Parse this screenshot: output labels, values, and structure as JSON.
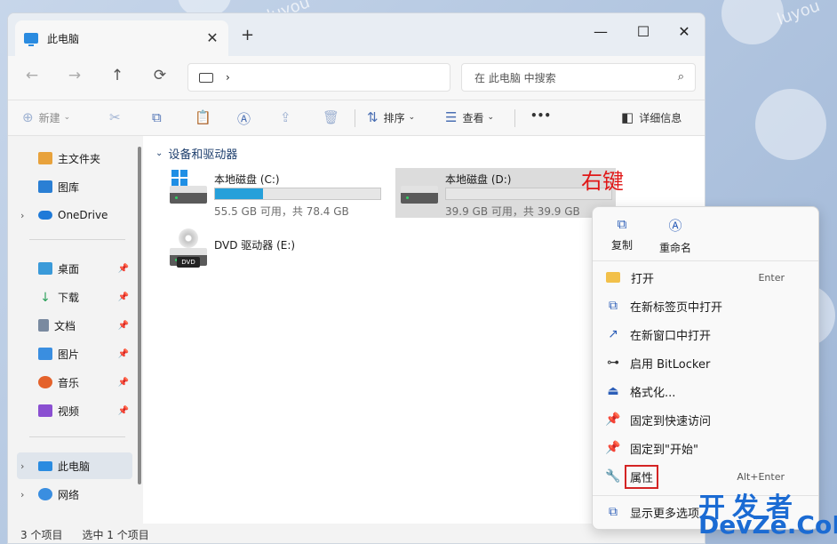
{
  "window": {
    "tab_title": "此电脑",
    "tab_close": "✕",
    "new_tab": "+",
    "minimize": "—",
    "maximize": "☐",
    "close": "✕"
  },
  "nav_buttons": {
    "back": "←",
    "forward": "→",
    "up": "↑",
    "refresh": "⟳"
  },
  "address": {
    "chevron": "›"
  },
  "search": {
    "placeholder": "在 此电脑 中搜索",
    "icon": "⌕"
  },
  "toolbar": {
    "new": "新建",
    "sort": "排序",
    "view": "查看",
    "more": "•••",
    "details": "详细信息"
  },
  "sidebar": {
    "items": [
      {
        "label": "主文件夹",
        "color": "#e8a23c"
      },
      {
        "label": "图库",
        "color": "#2a7fd4"
      },
      {
        "label": "OneDrive",
        "color": "#1f7ad8"
      },
      {
        "label": "桌面",
        "color": "#3a9ad9"
      },
      {
        "label": "下载",
        "color": "#2aa05a"
      },
      {
        "label": "文档",
        "color": "#7a8aa0"
      },
      {
        "label": "图片",
        "color": "#3a8ee0"
      },
      {
        "label": "音乐",
        "color": "#e4622b"
      },
      {
        "label": "视频",
        "color": "#8a4fd1"
      },
      {
        "label": "此电脑",
        "color": "#2a8be0"
      },
      {
        "label": "网络",
        "color": "#3a8ee0"
      }
    ]
  },
  "content": {
    "group_title": "设备和驱动器",
    "drives": [
      {
        "name": "本地磁盘 (C:)",
        "size": "55.5 GB 可用，共 78.4 GB",
        "used_fraction": 0.29
      },
      {
        "name": "本地磁盘 (D:)",
        "size": "39.9 GB 可用，共 39.9 GB",
        "used_fraction": 0.0
      },
      {
        "name": "DVD 驱动器 (E:)",
        "badge": "DVD"
      }
    ],
    "annotation": "右键"
  },
  "status": {
    "count": "3 个项目",
    "selected": "选中 1 个项目"
  },
  "context_menu": {
    "quick": [
      {
        "label": "复制"
      },
      {
        "label": "重命名"
      }
    ],
    "items": [
      {
        "label": "打开",
        "accel": "Enter"
      },
      {
        "label": "在新标签页中打开"
      },
      {
        "label": "在新窗口中打开"
      },
      {
        "label": "启用 BitLocker"
      },
      {
        "label": "格式化..."
      },
      {
        "label": "固定到快速访问"
      },
      {
        "label": "固定到\"开始\""
      },
      {
        "label": "属性",
        "accel": "Alt+Enter"
      },
      {
        "label": "显示更多选项"
      }
    ]
  },
  "watermark": {
    "line1": "开发者",
    "line2": "DevZe.CoM",
    "corner": "luyou"
  }
}
